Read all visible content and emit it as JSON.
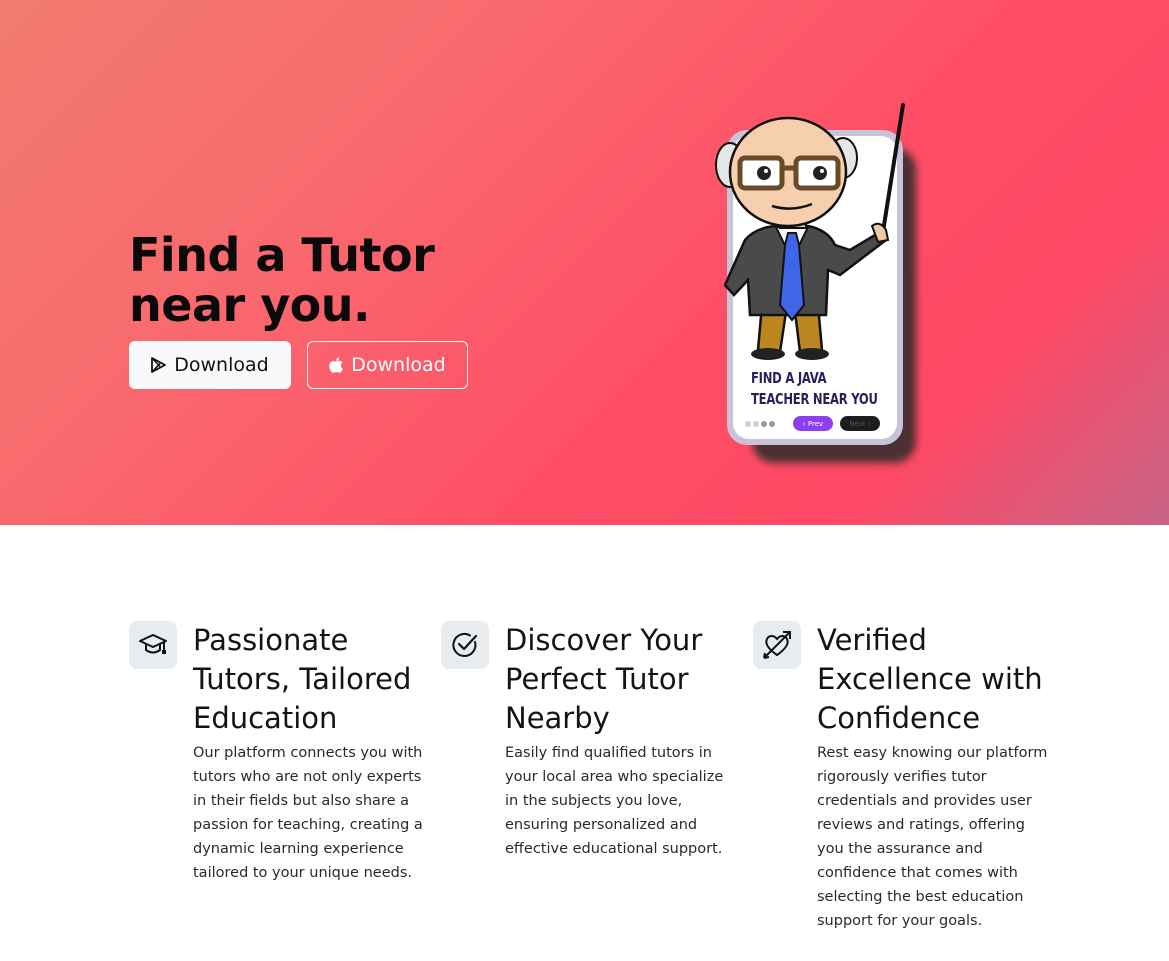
{
  "hero": {
    "title": "Find a Tutor near you.",
    "buttons": {
      "play_label": "Download",
      "apple_label": "Download"
    },
    "phone": {
      "caption": "FIND A JAVA TEACHER NEAR YOU",
      "prev_label": "‹ Prev",
      "next_label": "Next ›"
    }
  },
  "features": [
    {
      "icon": "graduation-cap-icon",
      "title": "Passionate Tutors, Tailored Education",
      "text": "Our platform connects you with tutors who are not only experts in their fields but also share a passion for teaching, creating a dynamic learning experience tailored to your unique needs."
    },
    {
      "icon": "check-circle-icon",
      "title": "Discover Your Perfect Tutor Nearby",
      "text": "Easily find qualified tutors in your local area who specialize in the subjects you love, ensuring personalized and effective educational support."
    },
    {
      "icon": "heart-arrow-icon",
      "title": "Verified Excellence with Confidence",
      "text": "Rest easy knowing our platform rigorously verifies tutor credentials and provides user reviews and ratings, offering you the assurance and confidence that comes with selecting the best education support for your goals."
    }
  ],
  "colors": {
    "hero_gradient_start": "#f27b70",
    "hero_gradient_mid": "#ff4864",
    "hero_gradient_end": "#c66487",
    "icon_box_bg": "#e9ecef",
    "prev_button": "#8c3ef0"
  }
}
